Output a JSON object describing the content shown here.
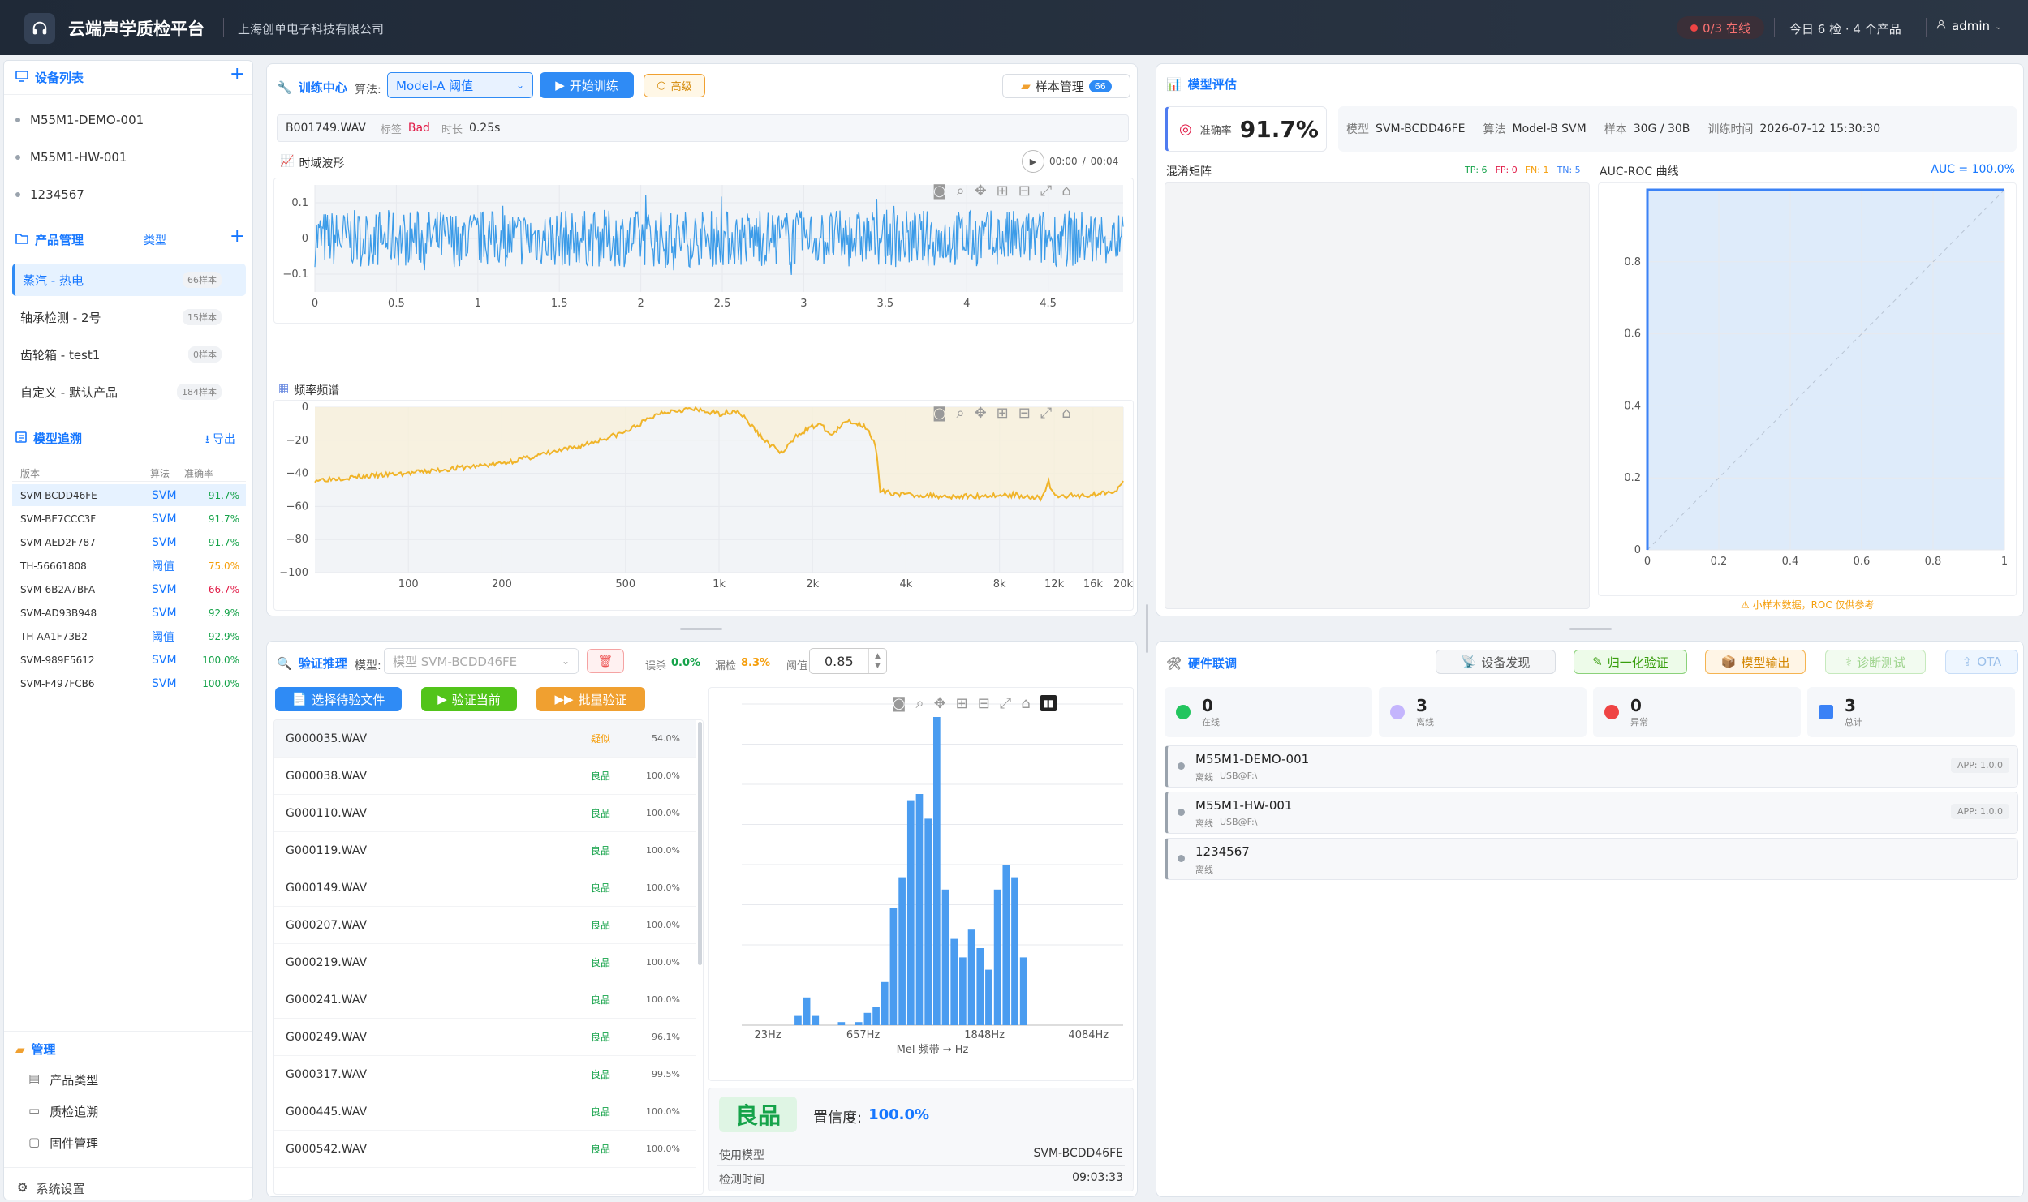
{
  "header": {
    "title": "云端声学质检平台",
    "company": "上海创单电子科技有限公司",
    "online_status": "0/3 在线",
    "today": "今日 6 检 · 4 个产品",
    "user": "admin"
  },
  "sidebar": {
    "devices_title": "设备列表",
    "devices": [
      "M55M1-DEMO-001",
      "M55M1-HW-001",
      "1234567"
    ],
    "products_title": "产品管理",
    "products_type": "类型",
    "products": [
      {
        "name": "蒸汽 - 热电",
        "count": "66样本"
      },
      {
        "name": "轴承检测 - 2号",
        "count": "15样本"
      },
      {
        "name": "齿轮箱 - test1",
        "count": "0样本"
      },
      {
        "name": "自定义 - 默认产品",
        "count": "184样本"
      }
    ],
    "models_title": "模型追溯",
    "export": "导出",
    "models_head": {
      "version": "版本",
      "algo": "算法",
      "acc": "准确率"
    },
    "models": [
      {
        "v": "SVM-BCDD46FE",
        "a": "SVM",
        "p": "91.7%",
        "c": "green"
      },
      {
        "v": "SVM-BE7CCC3F",
        "a": "SVM",
        "p": "91.7%",
        "c": "green"
      },
      {
        "v": "SVM-AED2F787",
        "a": "SVM",
        "p": "91.7%",
        "c": "green"
      },
      {
        "v": "TH-56661808",
        "a": "阈值",
        "p": "75.0%",
        "c": "orange"
      },
      {
        "v": "SVM-6B2A7BFA",
        "a": "SVM",
        "p": "66.7%",
        "c": "red"
      },
      {
        "v": "SVM-AD93B948",
        "a": "SVM",
        "p": "92.9%",
        "c": "green"
      },
      {
        "v": "TH-AA1F73B2",
        "a": "阈值",
        "p": "92.9%",
        "c": "green"
      },
      {
        "v": "SVM-989E5612",
        "a": "SVM",
        "p": "100.0%",
        "c": "green"
      },
      {
        "v": "SVM-F497FCB6",
        "a": "SVM",
        "p": "100.0%",
        "c": "green"
      }
    ],
    "manage_title": "管理",
    "manage": [
      "产品类型",
      "质检追溯",
      "固件管理"
    ],
    "settings": "系统设置"
  },
  "train": {
    "title": "训练中心",
    "algo_label": "算法:",
    "algo_value": "Model-A 阈值",
    "start": "开始训练",
    "advanced": "高级",
    "samples": "样本管理",
    "samples_count": "66",
    "file": "B001749.WAV",
    "tag_label": "标签",
    "tag": "Bad",
    "dur_label": "时长",
    "dur": "0.25s",
    "wave_title": "时域波形",
    "time_pos": "00:00",
    "time_sep": "/",
    "time_total": "00:04",
    "spec_title": "频率频谱"
  },
  "wave_chart": {
    "type": "line",
    "x_ticks": [
      "0",
      "0.5",
      "1",
      "1.5",
      "2",
      "2.5",
      "3",
      "3.5",
      "4",
      "4.5"
    ],
    "y_ticks": [
      "0.1",
      "0",
      "−0.1"
    ],
    "xlim": [
      0,
      4.96
    ],
    "ylim": [
      -0.15,
      0.15
    ]
  },
  "spec_chart": {
    "type": "area",
    "x_ticks": [
      "100",
      "200",
      "500",
      "1k",
      "2k",
      "4k",
      "8k",
      "12k",
      "16k",
      "20k"
    ],
    "y_ticks": [
      "0",
      "−20",
      "−40",
      "−60",
      "−80",
      "−100"
    ],
    "ylim": [
      -100,
      0
    ]
  },
  "verify": {
    "title": "验证推理",
    "model_label": "模型:",
    "model_value": "模型 SVM-BCDD46FE",
    "fp_label": "误杀",
    "fp": "0.0%",
    "fn_label": "漏检",
    "fn": "8.3%",
    "th_label": "阈值",
    "th": "0.85",
    "select": "选择待验文件",
    "current": "验证当前",
    "batch": "批量验证",
    "files": [
      {
        "n": "G000035.WAV",
        "r": "疑似",
        "p": "54.0%",
        "c": "orange"
      },
      {
        "n": "G000038.WAV",
        "r": "良品",
        "p": "100.0%",
        "c": "green"
      },
      {
        "n": "G000110.WAV",
        "r": "良品",
        "p": "100.0%",
        "c": "green"
      },
      {
        "n": "G000119.WAV",
        "r": "良品",
        "p": "100.0%",
        "c": "green"
      },
      {
        "n": "G000149.WAV",
        "r": "良品",
        "p": "100.0%",
        "c": "green"
      },
      {
        "n": "G000207.WAV",
        "r": "良品",
        "p": "100.0%",
        "c": "green"
      },
      {
        "n": "G000219.WAV",
        "r": "良品",
        "p": "100.0%",
        "c": "green"
      },
      {
        "n": "G000241.WAV",
        "r": "良品",
        "p": "100.0%",
        "c": "green"
      },
      {
        "n": "G000249.WAV",
        "r": "良品",
        "p": "96.1%",
        "c": "green"
      },
      {
        "n": "G000317.WAV",
        "r": "良品",
        "p": "99.5%",
        "c": "green"
      },
      {
        "n": "G000445.WAV",
        "r": "良品",
        "p": "100.0%",
        "c": "green"
      },
      {
        "n": "G000542.WAV",
        "r": "良品",
        "p": "100.0%",
        "c": "green"
      }
    ],
    "mel_xlabel": "Mel 频带 → Hz",
    "mel_ticks": [
      "23Hz",
      "657Hz",
      "1848Hz",
      "4084Hz"
    ],
    "result": "良品",
    "conf_label": "置信度:",
    "conf": "100.0%",
    "model_used_label": "使用模型",
    "model_used": "SVM-BCDD46FE",
    "time_label": "检测时间",
    "time": "09:03:33"
  },
  "chart_data": [
    {
      "type": "bar",
      "title": "",
      "xlabel": "Mel 频带 → Hz",
      "x_tick_labels": [
        "23Hz",
        "657Hz",
        "1848Hz",
        "4084Hz"
      ],
      "values": [
        0,
        0,
        0,
        0,
        0,
        0,
        0.03,
        0.09,
        0.03,
        0,
        0,
        0.01,
        0,
        0.01,
        0.04,
        0.06,
        0.14,
        0.38,
        0.48,
        0.73,
        0.75,
        0.67,
        1.0,
        0.44,
        0.28,
        0.22,
        0.31,
        0.25,
        0.18,
        0.44,
        0.52,
        0.48,
        0.22,
        0,
        0,
        0,
        0,
        0,
        0,
        0,
        0,
        0,
        0,
        0
      ]
    },
    {
      "type": "line",
      "title": "AUC-ROC 曲线",
      "x": [
        0,
        0,
        1
      ],
      "y": [
        0,
        1,
        1
      ],
      "xlim": [
        0,
        1
      ],
      "ylim": [
        0,
        1
      ],
      "x_ticks": [
        "0",
        "0.2",
        "0.4",
        "0.6",
        "0.8",
        "1"
      ],
      "y_ticks": [
        "0",
        "0.2",
        "0.4",
        "0.6",
        "0.8"
      ],
      "annotation": "AUC = 100.0%"
    }
  ],
  "eval": {
    "title": "模型评估",
    "acc_label": "准确率",
    "acc": "91.7%",
    "model_label": "模型",
    "model": "SVM-BCDD46FE",
    "algo_label": "算法",
    "algo": "Model-B SVM",
    "sample_label": "样本",
    "sample": "30G / 30B",
    "time_label": "训练时间",
    "time": "2026-07-12 15:30:30",
    "cm_title": "混淆矩阵",
    "tp": "TP: 6",
    "fp": "FP: 0",
    "fn": "FN: 1",
    "tn": "TN: 5",
    "roc_title": "AUC-ROC 曲线",
    "auc": "AUC = 100.0%",
    "warn": "⚠ 小样本数据，ROC 仅供参考"
  },
  "hw": {
    "title": "硬件联调",
    "discover": "设备发现",
    "normalize": "归一化验证",
    "export": "模型输出",
    "diag": "诊断测试",
    "ota": "OTA",
    "stats": [
      {
        "n": "0",
        "l": "在线",
        "c": "#22c55e"
      },
      {
        "n": "3",
        "l": "离线",
        "c": "#c4b5fd"
      },
      {
        "n": "0",
        "l": "异常",
        "c": "#ef4444"
      },
      {
        "n": "3",
        "l": "总计",
        "c": "#3b82f6"
      }
    ],
    "devices": [
      {
        "n": "M55M1-DEMO-001",
        "s": "离线",
        "p": "USB@F:\\",
        "a": "APP: 1.0.0"
      },
      {
        "n": "M55M1-HW-001",
        "s": "离线",
        "p": "USB@F:\\",
        "a": "APP: 1.0.0"
      },
      {
        "n": "1234567",
        "s": "离线",
        "p": "",
        "a": ""
      }
    ]
  },
  "colors": {
    "accent": "#1677ff",
    "good": "#16a34a",
    "wave": "#3b9be8",
    "spectrum": "#f0b429"
  }
}
